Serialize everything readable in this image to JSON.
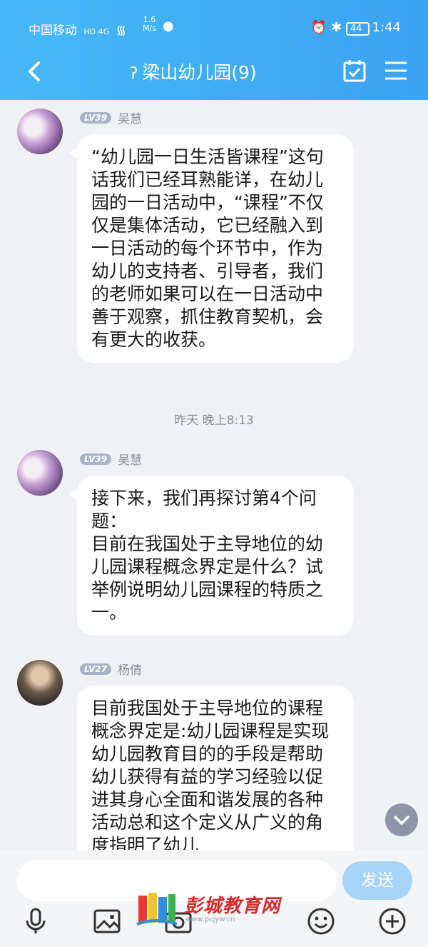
{
  "status": {
    "carrier": "中国移动",
    "network": "HD 4G",
    "speed_value": "1.6",
    "speed_unit": "M/s",
    "battery": "44",
    "time": "1:44"
  },
  "nav": {
    "title": "梁山幼儿园(9)"
  },
  "messages": [
    {
      "level": "LV39",
      "name": "吴慧",
      "text": "“幼儿园一日生活皆课程”这句话我们已经耳熟能详，在幼儿园的一日活动中，“课程”不仅仅是集体活动，它已经融入到一日活动的每个环节中，作为幼儿的支持者、引导者，我们的老师如果可以在一日活动中善于观察，抓住教育契机，会有更大的收获。"
    },
    {
      "level": "LV39",
      "name": "吴慧",
      "text": "接下来，我们再探讨第4个问题：\n目前在我国处于主导地位的幼儿园课程概念界定是什么？试举例说明幼儿园课程的特质之一。"
    },
    {
      "level": "LV27",
      "name": "杨倩",
      "text": "目前我国处于主导地位的课程概念界定是:幼儿园课程是实现幼儿园教育目的的手段是帮助幼儿获得有益的学习经验以促进其身心全面和谐发展的各种活动总和这个定义从广义的角度指明了幼儿"
    }
  ],
  "timestamp": "昨天 晚上8:13",
  "bottom": {
    "send_label": "发送",
    "watermark_title": "彭城教育网",
    "watermark_url": "www.pcjyw.cn"
  },
  "colors": {
    "header": "#3aa3f3",
    "send": "#a6d4fa",
    "background": "#f0f1f4"
  }
}
